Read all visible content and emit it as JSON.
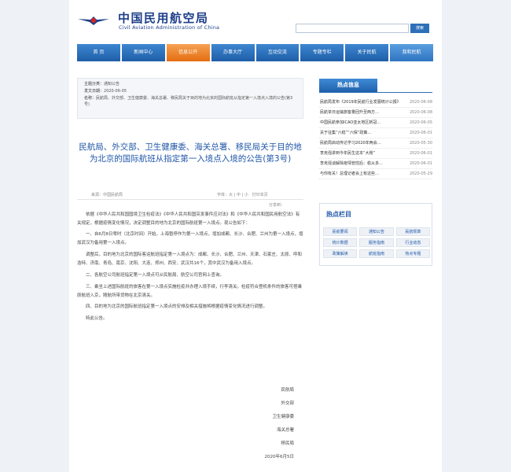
{
  "header": {
    "logo_cn": "中国民用航空局",
    "logo_en": "Civil Aviation Administration of China",
    "search_placeholder": "",
    "search_button": "搜索"
  },
  "nav": [
    "首 页",
    "新闻中心",
    "信息公开",
    "办事大厅",
    "互动交流",
    "专题专栏",
    "关于民航",
    "我和民航"
  ],
  "info": {
    "category_key": "主题分类：",
    "category_value": "通知公告",
    "date_key": "发文日期：",
    "date_value": "2020-06-05",
    "name_key": "名称：",
    "name_value": "民航局、外交部、卫生健康委、海关总署、移民局关于目的地为北京的国际航班从指定第一入境点入境的公告(第3号)"
  },
  "article": {
    "title": "民航局、外交部、卫生健康委、海关总署、移民局关于目的地为北京的国际航班从指定第一入境点入境的公告(第3号)",
    "source": "来源：中国民航局",
    "font_size": "字体：大 | 中 | 小　打印本页",
    "share": "分享到：",
    "paragraphs": [
      "依据《中华人民共和国国境卫生检疫法》《中华人民共和国突发事件应对法》和《中华人民共和国民用航空法》有关规定，根据疫情变化情况，决定调整目的地为北京的国际航班第一入境点。现公告如下：",
      "一、自6月8日零时（北京时间）开始，上海暂停作为第一入境点，增加成都、长沙、合肥、兰州为第一入境点，增加武汉为备用第一入境点。",
      "调整后，目的地为北京的国际客运航班指定第一入境点为：成都、长沙、合肥、兰州、天津、石家庄、太原、呼和浩特、济南、青岛、南京、沈阳、大连、郑州、西安、武汉共16个，其中武汉为备用入境点。",
      "二、各航空公司航班指定第一入境点可从民航局、航空公司官网上查询。",
      "三、乘坐上述国际航班的旅客在第一入境点实施检疫并办理入境手续，行李清关。检疫符合登机条件的旅客可搭乘原航班入京，随航所带货物在北京清关。",
      "四、目的地为北京的国际航班指定第一入境点的安排及相关措施将根据疫情变化情况进行调整。",
      "特此公告。"
    ],
    "signatures": [
      "民航局",
      "外交部",
      "卫生健康委",
      "海关总署",
      "移民局",
      "2020年6月5日"
    ]
  },
  "hot": {
    "title": "热点信息",
    "items": [
      {
        "text": "民航局发布《2019年民航行业发展统计公报》",
        "date": "2020-06-08"
      },
      {
        "text": "民航单日运输旅客量回升至西方…",
        "date": "2020-06-08"
      },
      {
        "text": "中国民航参加ICAO亚太地区新冠…",
        "date": "2020-06-05"
      },
      {
        "text": "关于征集“六稳”“六保”政策…",
        "date": "2020-06-01"
      },
      {
        "text": "民航局启动传达学习2020年两会…",
        "date": "2020-05-30"
      },
      {
        "text": "李克强讲到今年民生这本“大账”",
        "date": "2020-06-01"
      },
      {
        "text": "李克强谈解除疫情管控后：稳从多…",
        "date": "2020-06-01"
      },
      {
        "text": "与你有关！总理记者会上有这些…",
        "date": "2020-05-29"
      }
    ]
  },
  "columns": {
    "title": "热点栏目",
    "items": [
      "民航要闻",
      "通知公告",
      "民航规章",
      "统计数据",
      "服务指南",
      "行业动态",
      "政策解读",
      "航班指南",
      "热点专题"
    ]
  }
}
